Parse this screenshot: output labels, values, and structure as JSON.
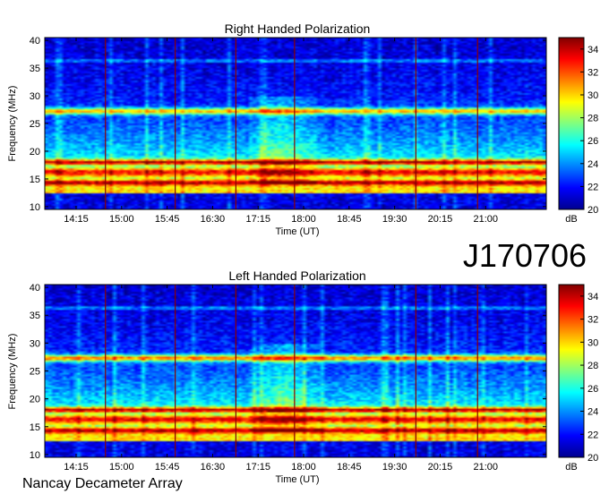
{
  "page": {
    "observation_id": "J170706",
    "instrument": "Nancay Decameter Array"
  },
  "chart_data": [
    {
      "type": "heatmap",
      "title": "Right Handed Polarization",
      "xlabel": "Time (UT)",
      "ylabel": "Frequency (MHz)",
      "colorbar_label": "dB",
      "xticks": [
        "14:15",
        "15:00",
        "15:45",
        "16:30",
        "17:15",
        "18:00",
        "18:45",
        "19:30",
        "20:15",
        "21:00"
      ],
      "xlim": [
        "13:44",
        "22:00"
      ],
      "ylim": [
        9.5,
        40.5
      ],
      "yticks": [
        10,
        15,
        20,
        25,
        30,
        35,
        40
      ],
      "zlim": [
        20,
        35
      ],
      "zticks": [
        20,
        22,
        24,
        26,
        28,
        30,
        32,
        34
      ],
      "colormap": "jet",
      "calibration_lines_ut": [
        "14:44",
        "15:53",
        "16:53",
        "17:51",
        "19:51",
        "20:52"
      ],
      "bands_mhz": [
        {
          "center": 27.2,
          "width": 1.2,
          "level": 30
        },
        {
          "center": 18.0,
          "width": 1.0,
          "level": 34
        },
        {
          "center": 16.2,
          "width": 1.5,
          "level": 33
        },
        {
          "center": 14.3,
          "width": 1.0,
          "level": 34
        },
        {
          "center": 36.3,
          "width": 0.4,
          "level": 25
        }
      ]
    },
    {
      "type": "heatmap",
      "title": "Left Handed Polarization",
      "xlabel": "Time (UT)",
      "ylabel": "Frequency (MHz)",
      "colorbar_label": "dB",
      "xticks": [
        "14:15",
        "15:00",
        "15:45",
        "16:30",
        "17:15",
        "18:00",
        "18:45",
        "19:30",
        "20:15",
        "21:00"
      ],
      "xlim": [
        "13:44",
        "22:00"
      ],
      "ylim": [
        9.5,
        40.5
      ],
      "yticks": [
        10,
        15,
        20,
        25,
        30,
        35,
        40
      ],
      "zlim": [
        20,
        35
      ],
      "zticks": [
        20,
        22,
        24,
        26,
        28,
        30,
        32,
        34
      ],
      "colormap": "jet",
      "calibration_lines_ut": [
        "14:44",
        "15:53",
        "16:53",
        "17:51",
        "19:51",
        "20:52"
      ],
      "bands_mhz": [
        {
          "center": 27.3,
          "width": 1.2,
          "level": 31
        },
        {
          "center": 18.0,
          "width": 1.0,
          "level": 34
        },
        {
          "center": 16.3,
          "width": 1.5,
          "level": 33
        },
        {
          "center": 14.3,
          "width": 1.0,
          "level": 34
        },
        {
          "center": 36.3,
          "width": 0.4,
          "level": 25
        }
      ]
    }
  ],
  "colors": {
    "calibration_line": "#8b0000",
    "frame": "#000000"
  }
}
